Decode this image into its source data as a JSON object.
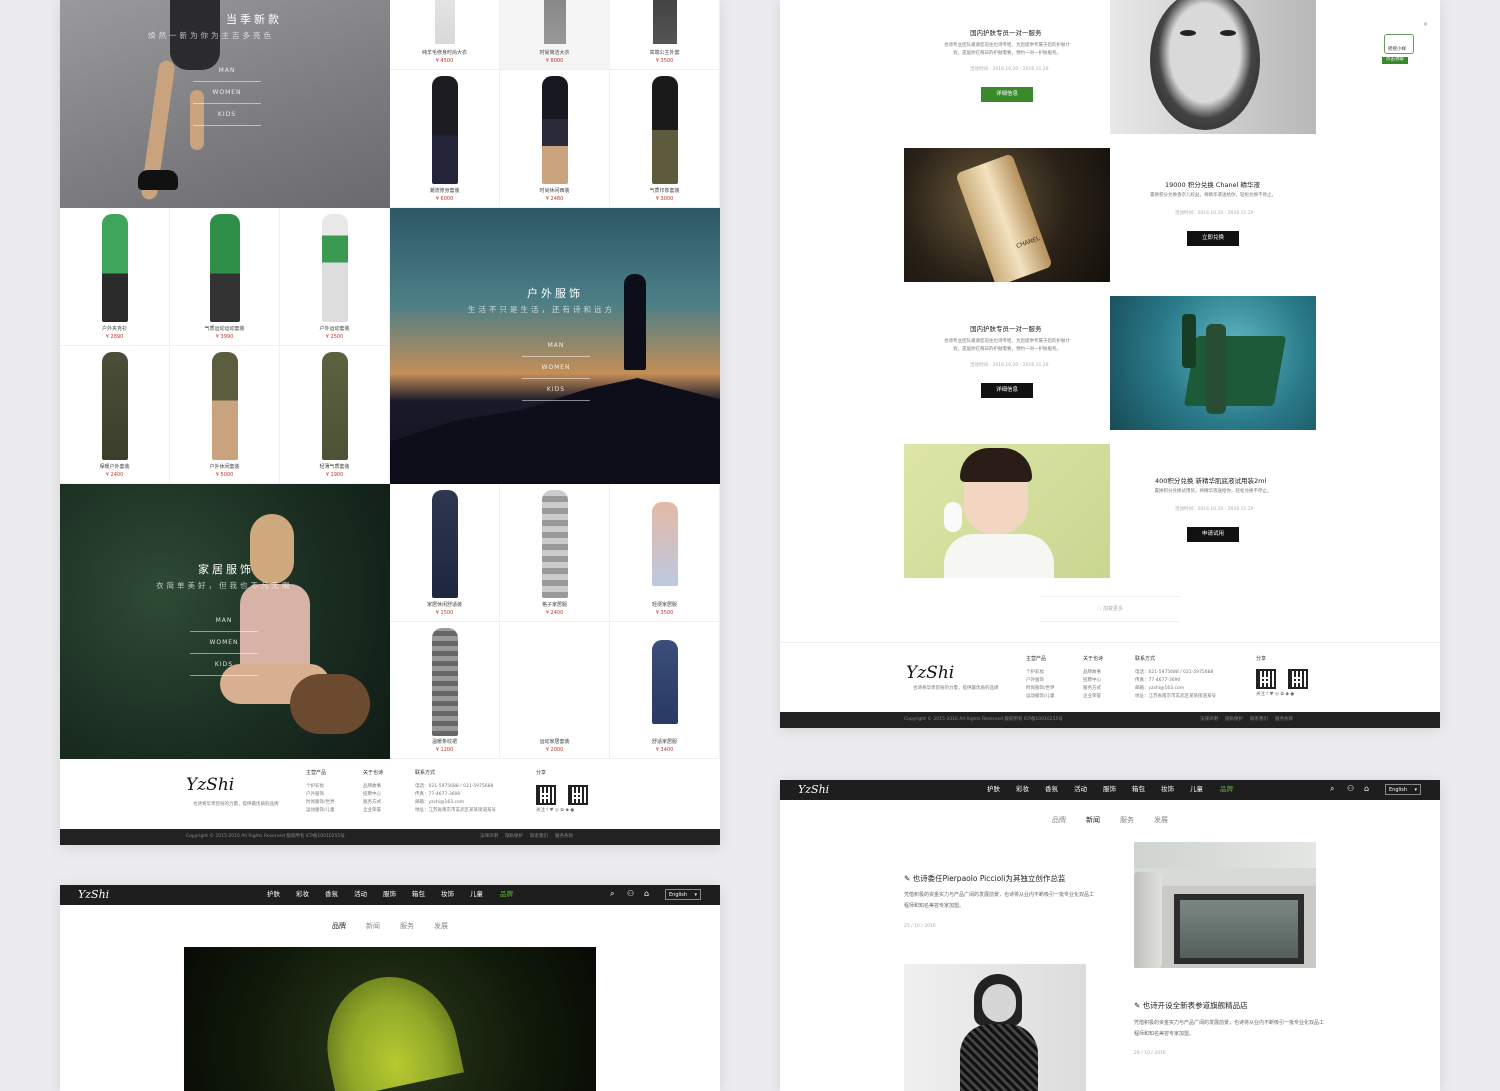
{
  "brand": {
    "logo_text": "YzShi",
    "logo_sub": "也诗"
  },
  "colors": {
    "accent_green": "#3a8a2c",
    "price_red": "#c0392b",
    "nav_bg": "#1e1e1e"
  },
  "hero_links": [
    "MAN",
    "WOMEN",
    "KIDS"
  ],
  "panel_home": {
    "hero_season": {
      "title": "当季新款",
      "subtitle": "焕然一新为你为主吉多亮色"
    },
    "hero_outdoor": {
      "title": "户外服饰",
      "subtitle": "生活不只是生活，还有诗和远方"
    },
    "hero_home": {
      "title": "家居服饰",
      "subtitle": "衣简单美好，但我也不凡无限"
    },
    "top_products": [
      {
        "name": "纯羊毛修身时尚大衣",
        "price": "¥ 4500"
      },
      {
        "name": "时尚简洁大衣",
        "price": "¥ 8000"
      },
      {
        "name": "高端公主外套",
        "price": "¥ 3500"
      },
      {
        "name": "潮流修身套装",
        "price": "¥ 6000"
      },
      {
        "name": "时尚休闲西装",
        "price": "¥ 2480"
      },
      {
        "name": "气质印象套装",
        "price": "¥ 3000"
      }
    ],
    "outdoor_products": [
      {
        "name": "户外夹克衫",
        "price": "¥ 2890"
      },
      {
        "name": "气质运动运动套装",
        "price": "¥ 3990"
      },
      {
        "name": "户外运动套装",
        "price": "¥ 2500"
      },
      {
        "name": "保暖户外套装",
        "price": "¥ 2400"
      },
      {
        "name": "户外休闲套装",
        "price": "¥ 5000"
      },
      {
        "name": "轻薄气质套装",
        "price": "¥ 1900"
      }
    ],
    "home_products": [
      {
        "name": "家居休闲舒适装",
        "price": "¥ 1500"
      },
      {
        "name": "格子家居服",
        "price": "¥ 2400"
      },
      {
        "name": "轻便家居服",
        "price": "¥ 3500"
      },
      {
        "name": "温暖条纹裙",
        "price": "¥ 1200"
      },
      {
        "name": "运动家居套装",
        "price": "¥ 2000"
      },
      {
        "name": "舒适家居服",
        "price": "¥ 3400"
      }
    ]
  },
  "footer": {
    "slogan": "也诗将华贵装扮的力量，提供最优质的品牌",
    "col1": {
      "title": "主营产品",
      "items": [
        "个护彩妆",
        "户外服饰",
        "时尚服饰/世界",
        "运动服饰/儿童"
      ]
    },
    "col2": {
      "title": "关于也诗",
      "items": [
        "品牌故事",
        "招聘中心",
        "服务方式",
        "企业荣誉"
      ]
    },
    "col3": {
      "title": "联系方式",
      "items": [
        "电话：021-5975688 / 021-5975688",
        "传真：77-4677-3690",
        "邮箱：yzshi@163.com",
        "地址：江苏省南京市玄武区某某街道某号"
      ]
    },
    "share": {
      "title": "分享",
      "follow": "关注 f ♥ ◎ ✿ ◆ ●"
    },
    "copyright": "Copyright © 2015-2016 All Rights Reserved 版权所有 ICP备10010255号",
    "links": [
      "法律声明",
      "隐私保护",
      "联系我们",
      "服务条款"
    ]
  },
  "promos": [
    {
      "title": "国内护肤专员一对一服务",
      "desc": "也诗专业团队邀请您前往也诗专柜，为您提供专属于您的护肤计划，遗留你在每日的护肤需要，预约一对一护肤服务。",
      "date": "活动时间：2016.10.20 - 2016.11.20",
      "button": "详细信息"
    },
    {
      "title": "19000 积分兑换 Chanel 精华液",
      "desc": "置换积分兑换香奈儿权益，将精华液送给你，轻松兑换不停止。",
      "date": "活动时间：2016.10.20 - 2016.11.20",
      "button": "立即兑换"
    },
    {
      "title": "国内护肤专员一对一服务",
      "desc": "也诗专业团队邀请您前往也诗专柜，为您提供专属于您的护肤计划，遗留你在每日的护肤需要，预约一对一护肤服务。",
      "date": "活动时间：2016.10.20 - 2016.11.20",
      "button": "详细信息"
    },
    {
      "title": "400积分兑换 新精华肌底液试用装2ml",
      "desc": "置换积分兑换试用装，将精华液送给你，轻松兑换不停止。",
      "date": "活动时间：2016.10.20 - 2016.11.20",
      "button": "申请试用"
    }
  ],
  "promo_image_label": "CHANEL",
  "load_more": "加载更多",
  "float_badge": {
    "line1": "摇摇小样",
    "line2": "点击领取"
  },
  "nav": {
    "items": [
      "护肤",
      "彩妆",
      "香氛",
      "活动",
      "服饰",
      "箱包",
      "妆饰",
      "儿童",
      "品牌"
    ],
    "active": "品牌",
    "lang": "English"
  },
  "tabs": [
    "品牌",
    "新闻",
    "服务",
    "发展"
  ],
  "news": [
    {
      "title": "也诗委任Pierpaolo Piccioli为其独立创作总监",
      "desc": "凭借积极的资金实力与产品广阔的发展前景，也诗将从业内不断吸引一批专业化双品工程师和知名美容专家加盟。",
      "date": "25 / 10 / 2016"
    },
    {
      "title": "也诗开设全新表参道旗舰精品店",
      "desc": "凭借积极的资金实力与产品广阔的发展前景，也诗将从业内不断吸引一批专业化双品工程师和知名美容专家加盟。",
      "date": "28 / 10 / 2016"
    }
  ]
}
